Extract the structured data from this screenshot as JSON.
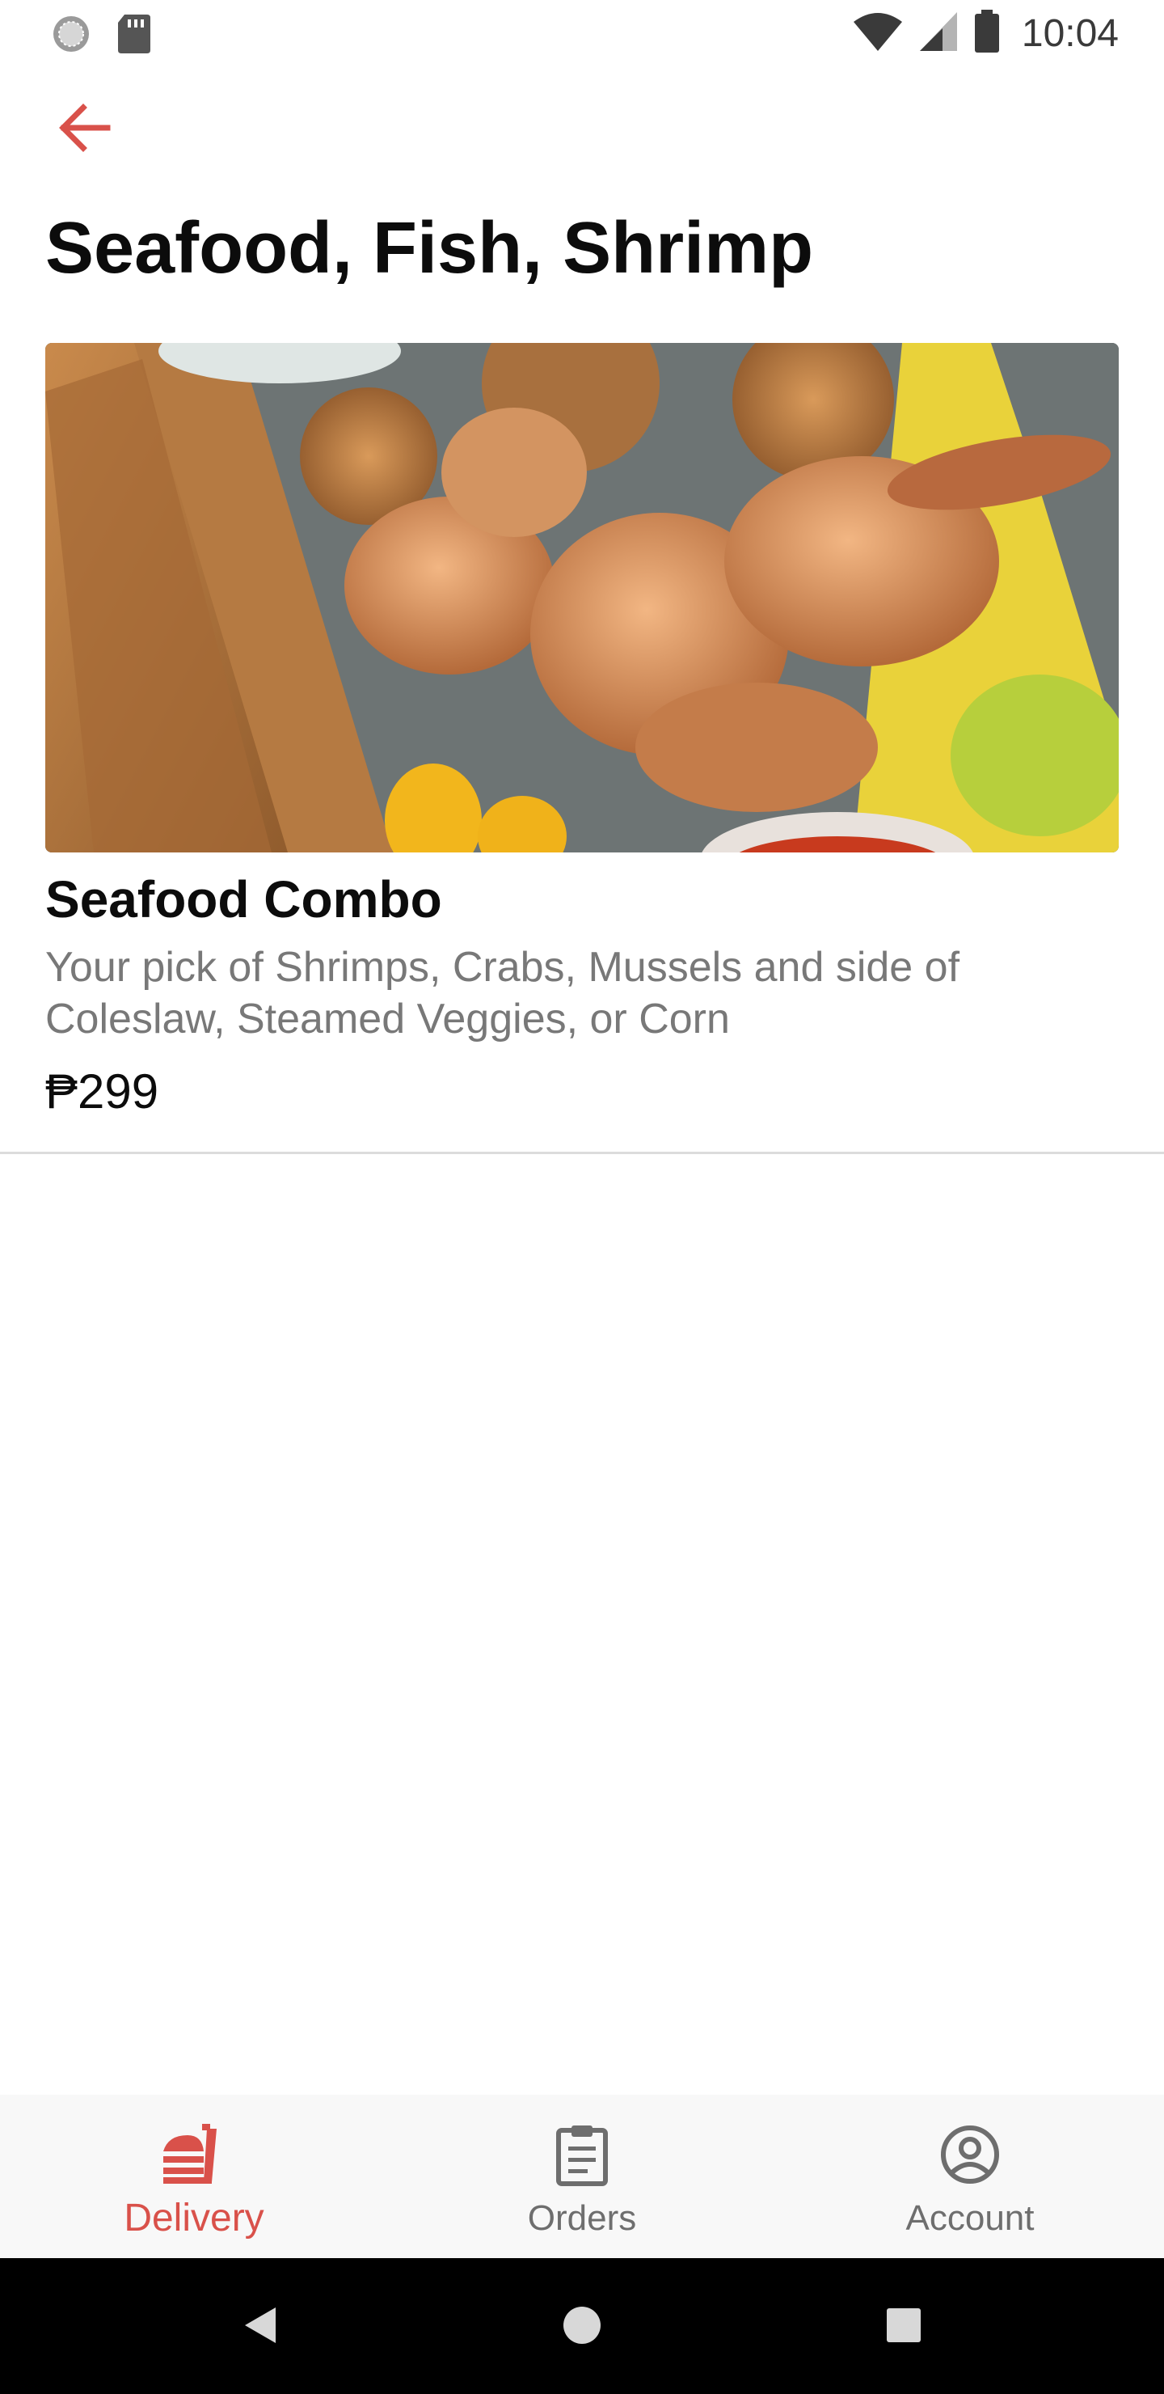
{
  "status_bar": {
    "time": "10:04",
    "left_icons": [
      "loading-circle-icon",
      "sd-card-icon"
    ],
    "right_icons": [
      "wifi-icon",
      "cellular-signal-icon",
      "battery-icon"
    ]
  },
  "header": {
    "back_icon": "arrow-left-icon",
    "title": "Seafood, Fish, Shrimp"
  },
  "menu_items": [
    {
      "name": "Seafood Combo",
      "description": "Your pick of Shrimps, Crabs, Mussels and side of Coleslaw, Steamed Veggies, or Corn",
      "price": "₱299",
      "image": "fried-seafood-platter-photo"
    }
  ],
  "bottom_nav": {
    "items": [
      {
        "label": "Delivery",
        "icon": "delivery-food-icon",
        "active": true
      },
      {
        "label": "Orders",
        "icon": "clipboard-icon",
        "active": false
      },
      {
        "label": "Account",
        "icon": "account-circle-icon",
        "active": false
      }
    ]
  },
  "system_nav": {
    "icons": [
      "back-triangle-icon",
      "home-circle-icon",
      "recents-square-icon"
    ]
  },
  "colors": {
    "accent": "#d9514a",
    "text_primary": "#0c0c0c",
    "text_secondary": "#787878",
    "nav_background": "#f8f8f8",
    "nav_inactive": "#6e6e6e"
  }
}
